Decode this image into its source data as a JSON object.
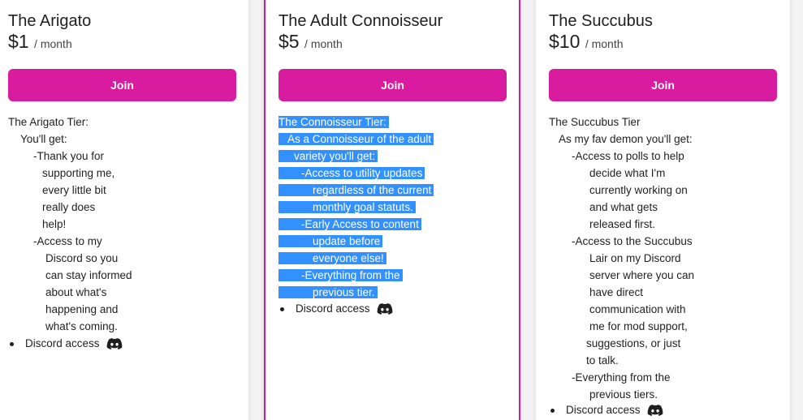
{
  "tiers": [
    {
      "title": "The Arigato",
      "price": "$1",
      "period": "/ month",
      "join_label": "Join",
      "description_lines": [
        "The Arigato Tier:",
        "You'll get:",
        "-Thank you for",
        "supporting me,",
        "every little bit",
        "really does",
        "help!",
        "-Access to my",
        "Discord so you",
        "can stay informed",
        "about what's",
        "happening and",
        "what's coming."
      ],
      "benefit": "Discord access",
      "benefit_icon": "discord-icon"
    },
    {
      "title": "The Adult Connoisseur",
      "price": "$5",
      "period": "/ month",
      "join_label": "Join",
      "description_lines": [
        "The Connoisseur Tier:",
        "As a Connoisseur of the adult",
        "variety you'll get:",
        "-Access to utility updates",
        "regardless of the current",
        "monthly goal statuts.",
        "-Early Access to content",
        "update before",
        "everyone else!",
        "-Everything from the",
        "previous tier."
      ],
      "benefit": "Discord access",
      "benefit_icon": "discord-icon",
      "selected": true
    },
    {
      "title": "The Succubus",
      "price": "$10",
      "period": "/ month",
      "join_label": "Join",
      "description_lines": [
        "The Succubus Tier",
        "As my fav demon you'll get:",
        "-Access to polls to help",
        "decide what I'm",
        "currently working on",
        "and what gets",
        "released first.",
        "-Access to the Succubus",
        "Lair on my Discord",
        "server where you can",
        "have direct",
        "communication with",
        "me for mod support,",
        "suggestions, or just",
        "to talk.",
        "-Everything from the",
        "previous tiers."
      ],
      "benefit": "Discord access",
      "benefit_icon": "discord-icon"
    }
  ],
  "colors": {
    "accent": "#d81b9f",
    "selected_border": "#c01fb0",
    "selection": "#3390ff"
  }
}
